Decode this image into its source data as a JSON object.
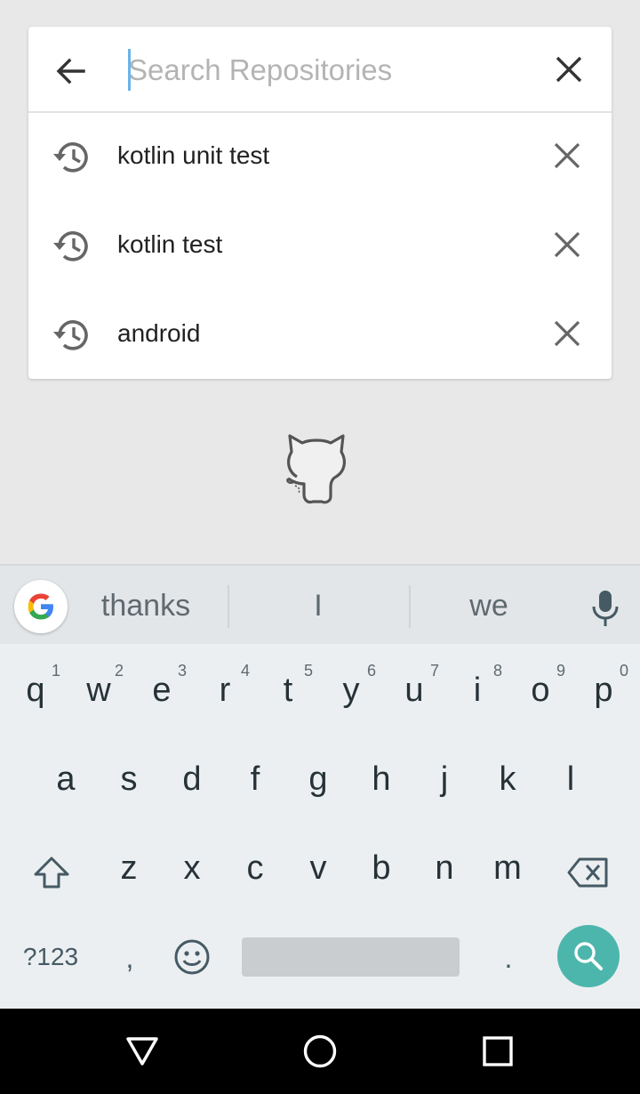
{
  "search": {
    "placeholder": "Search Repositories",
    "value": "",
    "back_icon": "arrow-back-icon",
    "clear_icon": "close-icon"
  },
  "history": [
    {
      "text": "kotlin unit test",
      "icon": "history-icon",
      "remove_icon": "close-icon"
    },
    {
      "text": "kotlin test",
      "icon": "history-icon",
      "remove_icon": "close-icon"
    },
    {
      "text": "android",
      "icon": "history-icon",
      "remove_icon": "close-icon"
    }
  ],
  "empty_state": {
    "icon": "octocat-icon"
  },
  "keyboard": {
    "suggestions": [
      "thanks",
      "I",
      "we"
    ],
    "rows": [
      [
        {
          "k": "q",
          "h": "1"
        },
        {
          "k": "w",
          "h": "2"
        },
        {
          "k": "e",
          "h": "3"
        },
        {
          "k": "r",
          "h": "4"
        },
        {
          "k": "t",
          "h": "5"
        },
        {
          "k": "y",
          "h": "6"
        },
        {
          "k": "u",
          "h": "7"
        },
        {
          "k": "i",
          "h": "8"
        },
        {
          "k": "o",
          "h": "9"
        },
        {
          "k": "p",
          "h": "0"
        }
      ],
      [
        {
          "k": "a"
        },
        {
          "k": "s"
        },
        {
          "k": "d"
        },
        {
          "k": "f"
        },
        {
          "k": "g"
        },
        {
          "k": "h"
        },
        {
          "k": "j"
        },
        {
          "k": "k"
        },
        {
          "k": "l"
        }
      ],
      [
        {
          "k": "z"
        },
        {
          "k": "x"
        },
        {
          "k": "c"
        },
        {
          "k": "v"
        },
        {
          "k": "b"
        },
        {
          "k": "n"
        },
        {
          "k": "m"
        }
      ]
    ],
    "symbols_label": "?123",
    "comma_label": ",",
    "period_label": ".",
    "accent_color": "#4db6ac",
    "icons": [
      "google-icon",
      "mic-icon",
      "shift-icon",
      "backspace-icon",
      "emoji-icon",
      "search-icon"
    ]
  },
  "navbar": {
    "icons": [
      "back-triangle-icon",
      "home-circle-icon",
      "recents-square-icon"
    ]
  }
}
